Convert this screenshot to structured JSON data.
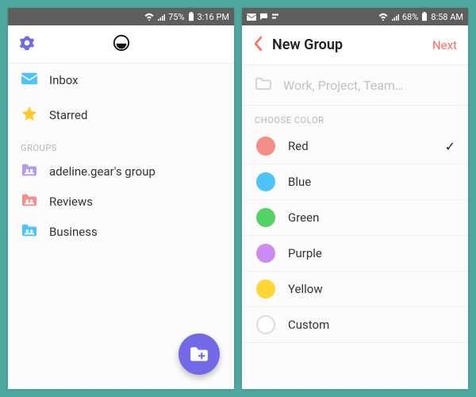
{
  "left": {
    "status": {
      "signal": "75%",
      "time": "3:16 PM"
    },
    "nav_items": {
      "inbox": "Inbox",
      "starred": "Starred"
    },
    "groups_label": "GROUPS",
    "groups": [
      {
        "label": "adeline.gear's group",
        "color": "#b39be8"
      },
      {
        "label": "Reviews",
        "color": "#f58d8a"
      },
      {
        "label": "Business",
        "color": "#4ec3f7"
      }
    ]
  },
  "right": {
    "status": {
      "signal": "68%",
      "time": "8:58 AM"
    },
    "title": "New Group",
    "next": "Next",
    "placeholder": "Work, Project, Team…",
    "choose_label": "CHOOSE COLOR",
    "colors": [
      {
        "label": "Red",
        "hex": "#f58d8a",
        "selected": true
      },
      {
        "label": "Blue",
        "hex": "#4ec3f7",
        "selected": false
      },
      {
        "label": "Green",
        "hex": "#55d266",
        "selected": false
      },
      {
        "label": "Purple",
        "hex": "#c98cf2",
        "selected": false
      },
      {
        "label": "Yellow",
        "hex": "#ffd633",
        "selected": false
      },
      {
        "label": "Custom",
        "hex": "",
        "selected": false
      }
    ]
  }
}
